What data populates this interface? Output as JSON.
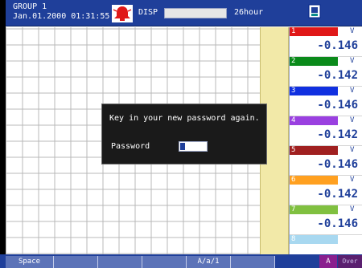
{
  "header": {
    "group": "GROUP 1",
    "datetime": "Jan.01.2000 01:31:55",
    "mode": "DISP",
    "period": "26hour",
    "alarm_icon": "alarm-bell-icon",
    "card_icon": "memory-card-icon"
  },
  "channels": [
    {
      "num": "1",
      "unit": "V",
      "value": "-0.146",
      "color": "#e01818"
    },
    {
      "num": "2",
      "unit": "V",
      "value": "-0.142",
      "color": "#0a8a1a"
    },
    {
      "num": "3",
      "unit": "V",
      "value": "-0.146",
      "color": "#1030e0"
    },
    {
      "num": "4",
      "unit": "V",
      "value": "-0.142",
      "color": "#9a40e0"
    },
    {
      "num": "5",
      "unit": "V",
      "value": "-0.146",
      "color": "#a02020"
    },
    {
      "num": "6",
      "unit": "V",
      "value": "-0.142",
      "color": "#ffa020"
    },
    {
      "num": "7",
      "unit": "V",
      "value": "-0.146",
      "color": "#80c040"
    },
    {
      "num": "8",
      "unit": "",
      "value": "",
      "color": "#a8d8f0"
    }
  ],
  "dialog": {
    "message": "Key in your new password again.",
    "password_label": "Password"
  },
  "footer": {
    "softkeys": [
      "Space",
      "",
      "",
      "",
      "A/a/1",
      ""
    ],
    "indicator_a": "A",
    "indicator_over": "Over"
  }
}
